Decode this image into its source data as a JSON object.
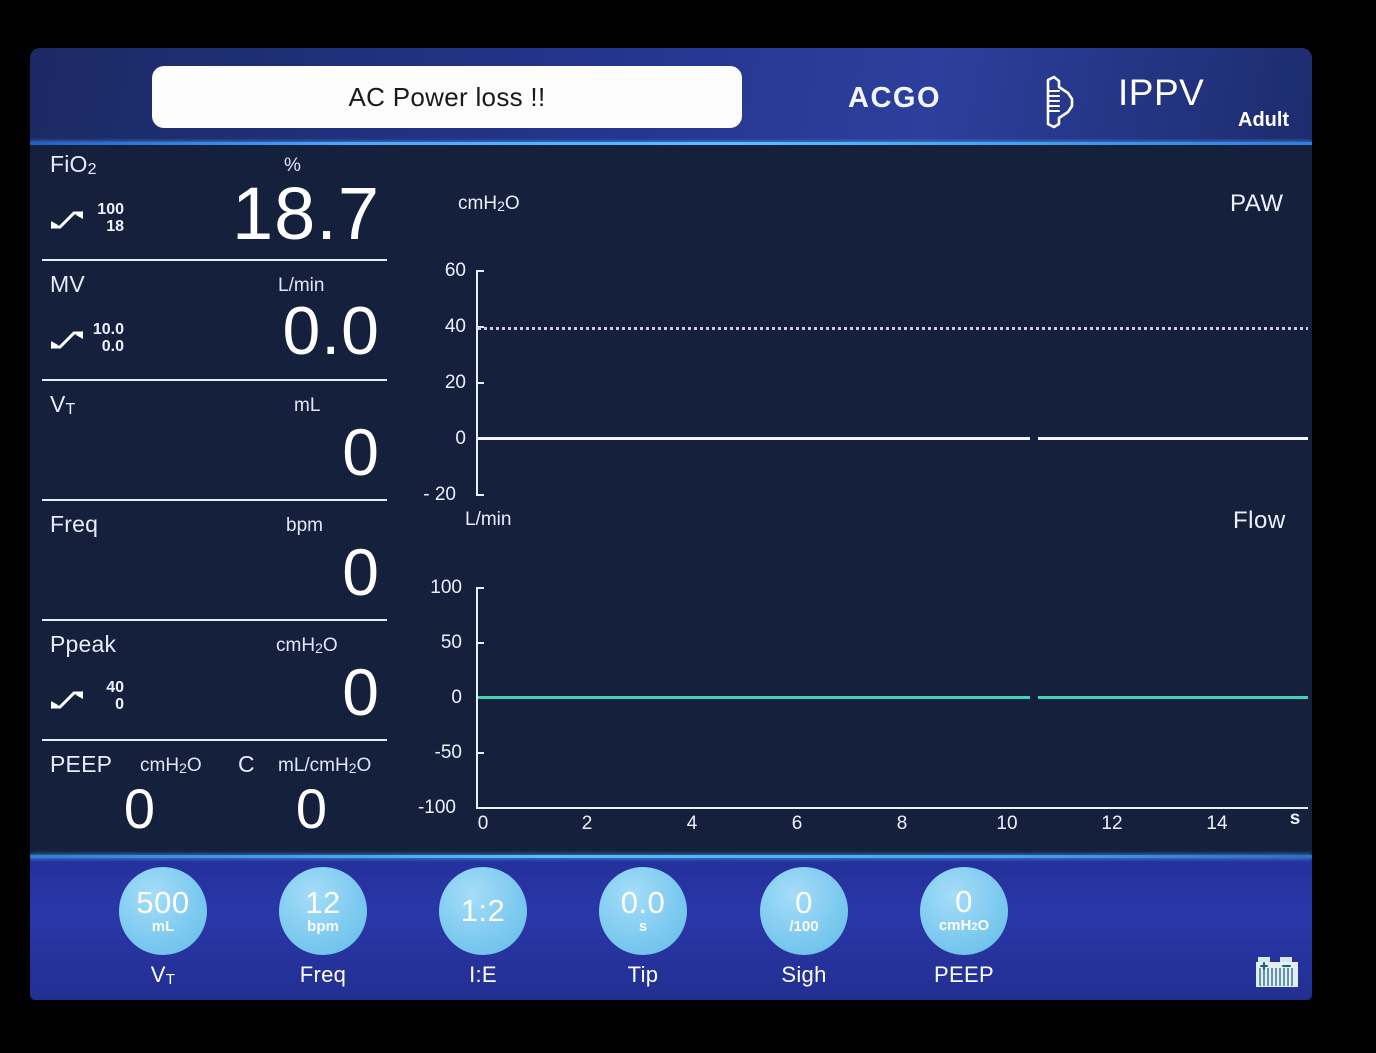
{
  "header": {
    "alarm_message": "AC Power loss !!",
    "acgo_label": "ACGO",
    "bellows_icon": "bellows-icon",
    "mode": "IPPV",
    "patient_type": "Adult"
  },
  "measured_parameters": [
    {
      "name": "FiO",
      "name_sub": "2",
      "unit": "%",
      "value": "18.7",
      "limit_high": "100",
      "limit_low": "18",
      "has_limits": true
    },
    {
      "name": "MV",
      "name_sub": "",
      "unit": "L/min",
      "value": "0.0",
      "limit_high": "10.0",
      "limit_low": "0.0",
      "has_limits": true
    },
    {
      "name": "V",
      "name_sub": "T",
      "unit": "mL",
      "value": "0",
      "limit_high": "",
      "limit_low": "",
      "has_limits": false
    },
    {
      "name": "Freq",
      "name_sub": "",
      "unit": "bpm",
      "value": "0",
      "limit_high": "",
      "limit_low": "",
      "has_limits": false
    },
    {
      "name": "Ppeak",
      "name_sub": "",
      "unit": "cmH2O",
      "value": "0",
      "limit_high": "40",
      "limit_low": "0",
      "has_limits": true
    }
  ],
  "split_row": {
    "left_name": "PEEP",
    "left_unit": "cmH2O",
    "left_value": "0",
    "right_name": "C",
    "right_unit": "mL/cmH2O",
    "right_value": "0"
  },
  "chart_data": [
    {
      "type": "line",
      "title": "PAW",
      "ylabel": "cmH2O",
      "xlabel": "s",
      "yticks": [
        "60",
        "40",
        "20",
        "0",
        "- 20"
      ],
      "ytick_values": [
        60,
        40,
        20,
        0,
        -20
      ],
      "ylim": [
        -20,
        60
      ],
      "xlim": [
        0,
        15.4
      ],
      "grid": false,
      "trace_color": "#f2f5ff",
      "series": [
        {
          "name": "PAW",
          "x": [
            0,
            10.2
          ],
          "values": [
            0,
            0
          ]
        },
        {
          "name": "PAW",
          "x": [
            10.6,
            15.4
          ],
          "values": [
            0,
            0
          ]
        }
      ],
      "annotations": [
        {
          "type": "alarm-limit-line",
          "label": "Ppeak high alarm",
          "value": 40,
          "color": "#cdc2f5",
          "style": "dotted"
        }
      ]
    },
    {
      "type": "line",
      "title": "Flow",
      "ylabel": "L/min",
      "xlabel": "s",
      "yticks": [
        "100",
        "50",
        "0",
        "-50",
        "-100"
      ],
      "ytick_values": [
        100,
        50,
        0,
        -50,
        -100
      ],
      "ylim": [
        -100,
        100
      ],
      "xlim": [
        0,
        15.4
      ],
      "xticks": [
        "0",
        "2",
        "4",
        "6",
        "8",
        "10",
        "12",
        "14"
      ],
      "xtick_values": [
        0,
        2,
        4,
        6,
        8,
        10,
        12,
        14
      ],
      "grid": false,
      "trace_color": "#3fd3b5",
      "series": [
        {
          "name": "Flow",
          "x": [
            0,
            10.2
          ],
          "values": [
            0,
            0
          ]
        },
        {
          "name": "Flow",
          "x": [
            10.6,
            15.4
          ],
          "values": [
            0,
            0
          ]
        }
      ]
    }
  ],
  "x_axis": {
    "ticks": [
      "0",
      "2",
      "4",
      "6",
      "8",
      "10",
      "12",
      "14"
    ],
    "unit": "s"
  },
  "settings": [
    {
      "value": "500",
      "subunit": "mL",
      "label": "V",
      "label_sub": "T"
    },
    {
      "value": "12",
      "subunit": "bpm",
      "label": "Freq",
      "label_sub": ""
    },
    {
      "value": "1:2",
      "subunit": "",
      "label": "I:E",
      "label_sub": ""
    },
    {
      "value": "0.0",
      "subunit": "s",
      "label": "Tip",
      "label_sub": ""
    },
    {
      "value": "0",
      "subunit": "/100",
      "label": "Sigh",
      "label_sub": ""
    },
    {
      "value": "0",
      "subunit": "cmH2O",
      "label": "PEEP",
      "label_sub": ""
    }
  ],
  "status": {
    "battery_icon": "battery-icon"
  },
  "colors": {
    "screen_bg": "#141f3c",
    "header_blue": "#24358e",
    "settings_blue": "#2a37a8",
    "bubble_cyan": "#7ecaf0",
    "paw_trace": "#f2f5ff",
    "flow_trace": "#3fd3b5",
    "alarm_line": "#cdc2f5",
    "alarm_banner_bg": "#fdfdfd"
  }
}
